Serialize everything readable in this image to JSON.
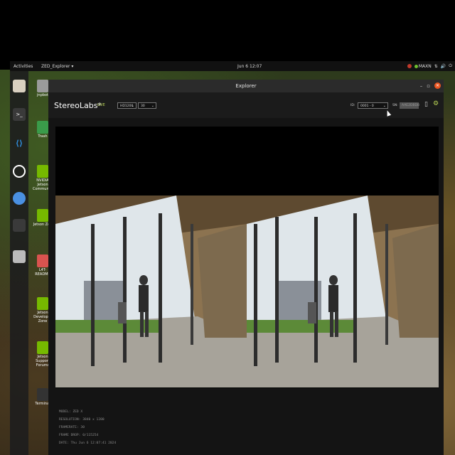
{
  "topbar": {
    "activities": "Activities",
    "app_menu": "ZED_Explorer ▾",
    "clock": "Jun 6  12:07",
    "power_mode": "MAXN",
    "tray_icons": [
      "record-icon",
      "nvidia-icon",
      "network-icon",
      "volume-icon",
      "power-icon"
    ]
  },
  "dock": {
    "items": [
      "files",
      "terminal",
      "vscode",
      "obs",
      "chromium",
      "blank",
      "drive"
    ]
  },
  "desktop_icons": [
    {
      "label": "jnpbot",
      "color": "#9b9b9b"
    },
    {
      "label": "Trash",
      "color": "#3a9b4a"
    },
    {
      "label": "NVIDIA Jetson Community",
      "color": "#76b900"
    },
    {
      "label": "Jetson Zoo",
      "color": "#76b900"
    },
    {
      "label": "L4T-README",
      "color": "#d9534f"
    },
    {
      "label": "Jetson Developer Zone",
      "color": "#76b900"
    },
    {
      "label": "Jetson Support Forums",
      "color": "#76b900"
    },
    {
      "label": "Terminal",
      "color": "#333333"
    }
  ],
  "window": {
    "title": "Explorer"
  },
  "app": {
    "brand": "StereoLabs*",
    "live_label": "LIVE",
    "resolution_select": "HD1200",
    "fps_select": "30",
    "id_label": "ID:",
    "id_select": "0001 - 0",
    "sn_label": "SN:",
    "sn_value": "AAE2DBDB"
  },
  "colors": {
    "accent": "#b9d455",
    "window_bg": "#141414",
    "close_button": "#e95420"
  },
  "info": {
    "model": "MODEL: ZED X",
    "resolution": "RESOLUTION: 3840 x 1200",
    "framerate": "FRAMERATE: 30",
    "frame_drop": "FRAME DROP: 0/115254",
    "date": "DATE: Thu Jun 6 12:07:41 2024"
  }
}
